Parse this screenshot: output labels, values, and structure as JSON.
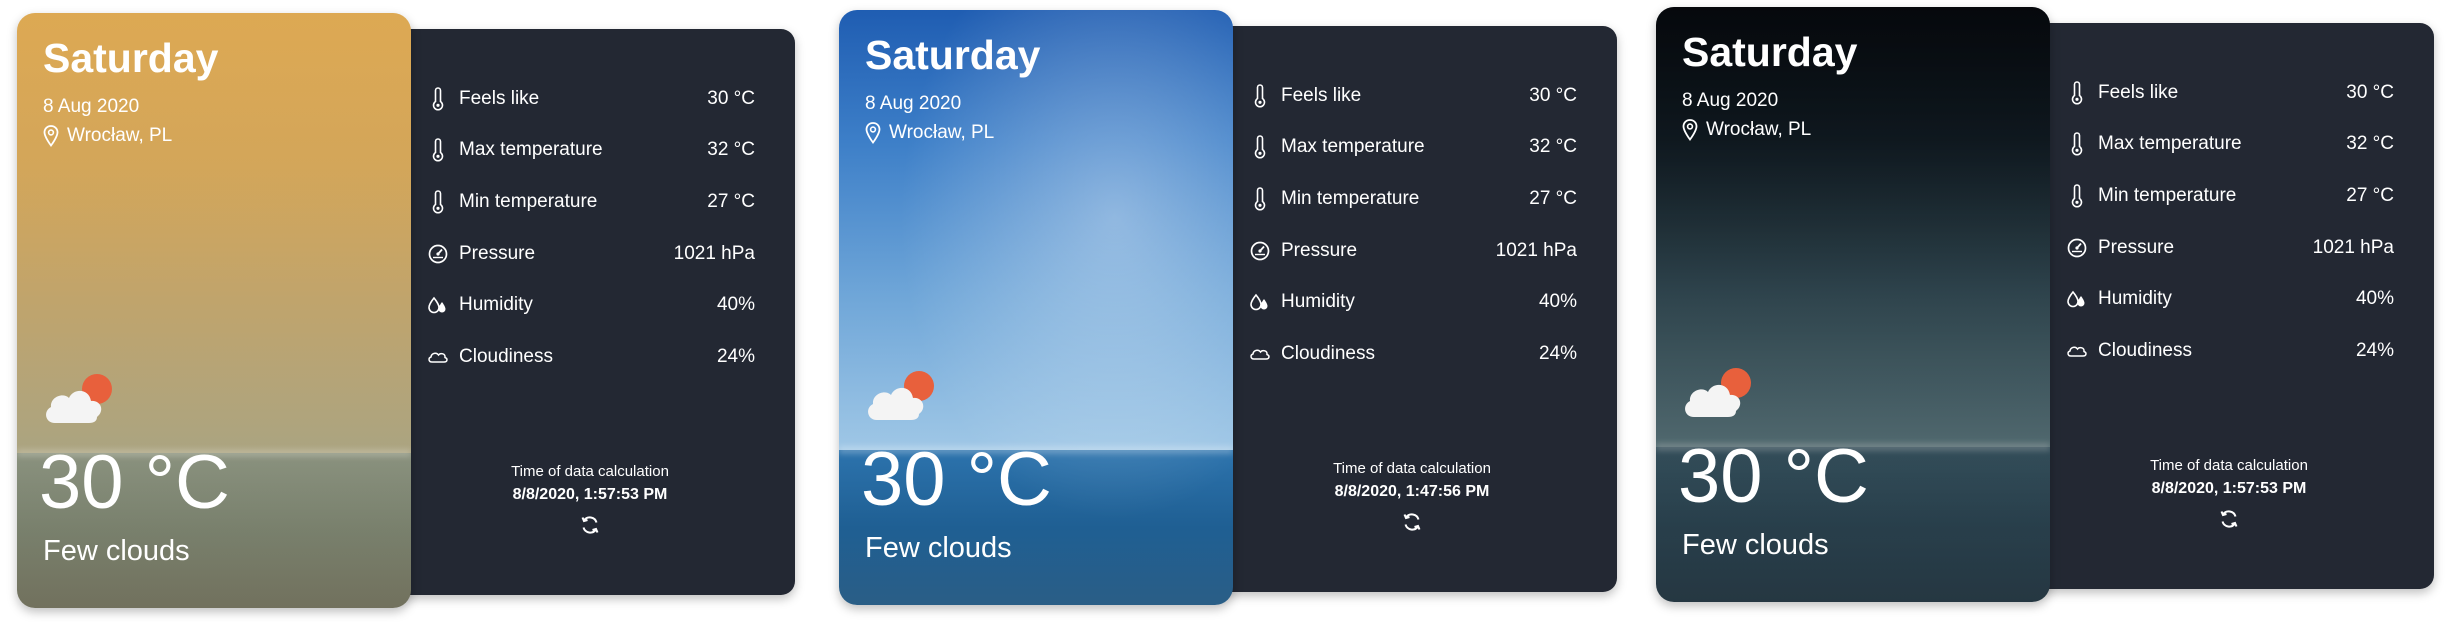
{
  "widgets": [
    {
      "day": "Saturday",
      "date": "8 Aug 2020",
      "location": "Wrocław, PL",
      "temperature": "30 °C",
      "condition": "Few clouds",
      "condition_icon": "cloud-sun-icon",
      "background_theme": "golden-sunset",
      "details": [
        {
          "icon": "thermometer-icon",
          "label": "Feels like",
          "value": "30 °C"
        },
        {
          "icon": "thermometer-icon",
          "label": "Max temperature",
          "value": "32 °C"
        },
        {
          "icon": "thermometer-icon",
          "label": "Min temperature",
          "value": "27 °C"
        },
        {
          "icon": "gauge-icon",
          "label": "Pressure",
          "value": "1021 hPa"
        },
        {
          "icon": "droplets-icon",
          "label": "Humidity",
          "value": "40%"
        },
        {
          "icon": "cloud-outline-icon",
          "label": "Cloudiness",
          "value": "24%"
        }
      ],
      "calc_label": "Time of data calculation",
      "calc_time": "8/8/2020, 1:57:53 PM"
    },
    {
      "day": "Saturday",
      "date": "8 Aug 2020",
      "location": "Wrocław, PL",
      "temperature": "30 °C",
      "condition": "Few clouds",
      "condition_icon": "cloud-sun-icon",
      "background_theme": "blue-sky",
      "details": [
        {
          "icon": "thermometer-icon",
          "label": "Feels like",
          "value": "30 °C"
        },
        {
          "icon": "thermometer-icon",
          "label": "Max temperature",
          "value": "32 °C"
        },
        {
          "icon": "thermometer-icon",
          "label": "Min temperature",
          "value": "27 °C"
        },
        {
          "icon": "gauge-icon",
          "label": "Pressure",
          "value": "1021 hPa"
        },
        {
          "icon": "droplets-icon",
          "label": "Humidity",
          "value": "40%"
        },
        {
          "icon": "cloud-outline-icon",
          "label": "Cloudiness",
          "value": "24%"
        }
      ],
      "calc_label": "Time of data calculation",
      "calc_time": "8/8/2020, 1:47:56 PM"
    },
    {
      "day": "Saturday",
      "date": "8 Aug 2020",
      "location": "Wrocław, PL",
      "temperature": "30 °C",
      "condition": "Few clouds",
      "condition_icon": "cloud-sun-icon",
      "background_theme": "dark-night",
      "details": [
        {
          "icon": "thermometer-icon",
          "label": "Feels like",
          "value": "30 °C"
        },
        {
          "icon": "thermometer-icon",
          "label": "Max temperature",
          "value": "32 °C"
        },
        {
          "icon": "thermometer-icon",
          "label": "Min temperature",
          "value": "27 °C"
        },
        {
          "icon": "gauge-icon",
          "label": "Pressure",
          "value": "1021 hPa"
        },
        {
          "icon": "droplets-icon",
          "label": "Humidity",
          "value": "40%"
        },
        {
          "icon": "cloud-outline-icon",
          "label": "Cloudiness",
          "value": "24%"
        }
      ],
      "calc_label": "Time of data calculation",
      "calc_time": "8/8/2020, 1:57:53 PM"
    }
  ],
  "colors": {
    "panel_bg": "#232833",
    "text": "#ffffff",
    "sun": "#e8603c",
    "cloud": "#f4f4f4"
  },
  "refresh_icon": "refresh-icon"
}
